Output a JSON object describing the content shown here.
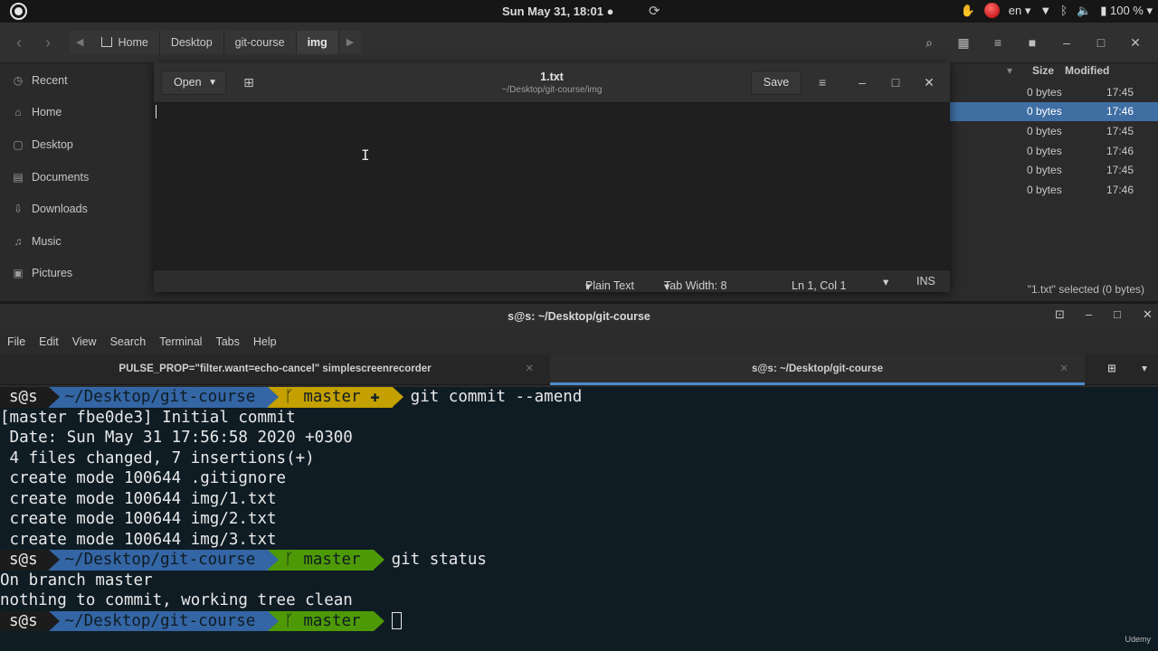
{
  "topbar": {
    "clock": "Sun May 31, 18:01 ●",
    "lang": "en",
    "battery": "100 %"
  },
  "files": {
    "breadcrumbs": [
      "Home",
      "Desktop",
      "git-course",
      "img"
    ],
    "sidebar": [
      "Recent",
      "Home",
      "Desktop",
      "Documents",
      "Downloads",
      "Music",
      "Pictures"
    ],
    "columns": {
      "size": "Size",
      "modified": "Modified"
    },
    "rows": [
      {
        "size": "0 bytes",
        "modified": "17:45"
      },
      {
        "size": "0 bytes",
        "modified": "17:46"
      },
      {
        "size": "0 bytes",
        "modified": "17:45"
      },
      {
        "size": "0 bytes",
        "modified": "17:46"
      },
      {
        "size": "0 bytes",
        "modified": "17:45"
      },
      {
        "size": "0 bytes",
        "modified": "17:46"
      }
    ],
    "status": "\"1.txt\" selected (0 bytes)"
  },
  "editor": {
    "open_label": "Open",
    "title": "1.txt",
    "path": "~/Desktop/git-course/img",
    "save_label": "Save",
    "language": "Plain Text",
    "tab_width": "Tab Width: 8",
    "position": "Ln 1, Col 1",
    "mode": "INS"
  },
  "terminal": {
    "window_title": "s@s: ~/Desktop/git-course",
    "menu": [
      "File",
      "Edit",
      "View",
      "Search",
      "Terminal",
      "Tabs",
      "Help"
    ],
    "tabs": [
      "PULSE_PROP=\"filter.want=echo-cancel\" simplescreenrecorder",
      "s@s: ~/Desktop/git-course"
    ],
    "prompt": {
      "user": "s@s",
      "path": "~/Desktop/git-course",
      "branch": "ᚴ master",
      "branch_dirty": "ᚴ master ✚"
    },
    "commands": [
      "git commit --amend",
      "git status"
    ],
    "output1": [
      "[master fbe0de3] Initial commit",
      " Date: Sun May 31 17:56:58 2020 +0300",
      " 4 files changed, 7 insertions(+)",
      " create mode 100644 .gitignore",
      " create mode 100644 img/1.txt",
      " create mode 100644 img/2.txt",
      " create mode 100644 img/3.txt"
    ],
    "output2": [
      "On branch master",
      "nothing to commit, working tree clean"
    ]
  },
  "watermark": "Udemy",
  "colors": {
    "prompt_path": "#3465a4",
    "prompt_git": "#4e9a06",
    "prompt_dirty": "#c4a000",
    "selection": "#3f6ea3",
    "terminal_bg": "#0f1c24"
  }
}
